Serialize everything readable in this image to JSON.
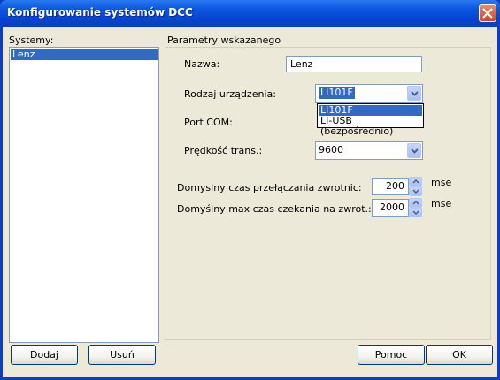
{
  "window": {
    "title": "Konfigurowanie systemów DCC"
  },
  "systems": {
    "label": "Systemy:",
    "items": [
      "Lenz"
    ]
  },
  "params": {
    "group_label": "Parametry wskazanego",
    "name_label": "Nazwa:",
    "name_value": "Lenz",
    "device_label": "Rodzaj urządzenia:",
    "device_value": "LI101F",
    "device_options": [
      "LI101F",
      "LI-USB (bezpośrednio)"
    ],
    "port_label": "Port COM:",
    "speed_label": "Prędkość trans.:",
    "speed_value": "9600",
    "switch_time_label": "Domyslny czas przełączania zwrotnic:",
    "switch_time_value": "200",
    "switch_time_unit": "mse",
    "wait_time_label": "Domyślny max czas czekania na zwrot.:",
    "wait_time_value": "2000",
    "wait_time_unit": "mse"
  },
  "buttons": {
    "add": "Dodaj",
    "remove": "Usuń",
    "help": "Pomoc",
    "ok": "OK"
  },
  "colors": {
    "titlebar": "#0b56e0",
    "selection": "#316ac5",
    "dialog": "#ece9d8"
  }
}
